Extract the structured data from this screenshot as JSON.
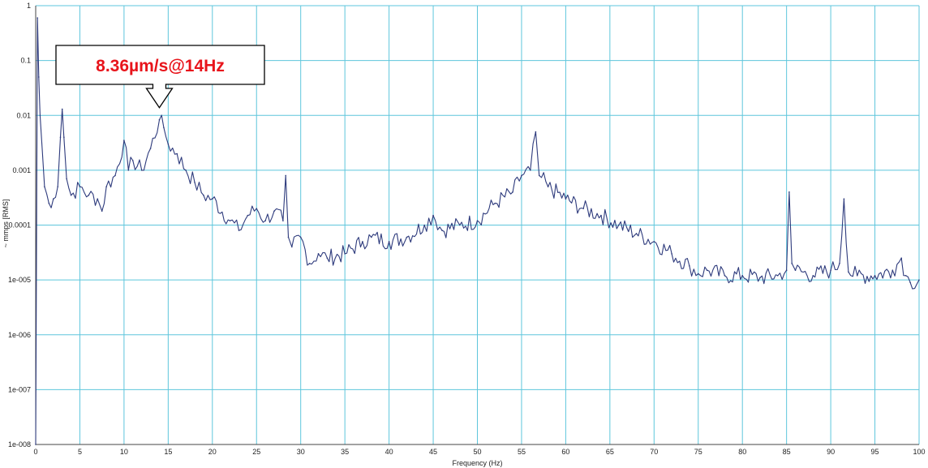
{
  "chart_data": {
    "type": "line",
    "xlabel": "Frequency (Hz)",
    "ylabel": "~ mmps [RMS]",
    "xlim": [
      0,
      100
    ],
    "ylim": [
      1e-08,
      1
    ],
    "yscale": "log",
    "grid": true,
    "x_tick_labels": [
      "0",
      "5",
      "10",
      "15",
      "20",
      "25",
      "30",
      "35",
      "40",
      "45",
      "50",
      "55",
      "60",
      "65",
      "70",
      "75",
      "80",
      "85",
      "90",
      "95",
      "100"
    ],
    "y_tick_labels": [
      "1",
      "0.1",
      "0.01",
      "0.001",
      "0.0001",
      "1e-005",
      "1e-006",
      "1e-007",
      "1e-008"
    ],
    "series": [
      {
        "color": "#2d3a7c",
        "x": [
          0,
          0.2,
          0.35,
          0.5,
          1.0,
          1.5,
          2.0,
          2.5,
          2.8,
          3.0,
          3.2,
          3.5,
          4.0,
          5.0,
          6.0,
          7.0,
          7.5,
          8.0,
          9.0,
          10.0,
          10.5,
          11.0,
          12.0,
          13.0,
          14.0,
          14.5,
          15.0,
          16.0,
          17.0,
          18.0,
          19.0,
          20.0,
          22.0,
          23.0,
          24.0,
          25.0,
          26.0,
          27.0,
          28.0,
          28.3,
          28.6,
          29.0,
          30.0,
          31.0,
          32.0,
          33.0,
          35.0,
          37.0,
          38.0,
          40.0,
          42.0,
          44.0,
          45.0,
          46.0,
          48.0,
          50.0,
          52.0,
          54.0,
          55.0,
          56.0,
          56.6,
          57.0,
          58.0,
          60.0,
          62.0,
          64.0,
          66.0,
          68.0,
          70.0,
          72.0,
          74.0,
          75.0,
          76.0,
          78.0,
          80.0,
          82.0,
          84.0,
          85.0,
          85.3,
          85.6,
          86.0,
          88.0,
          90.0,
          91.0,
          91.5,
          92.0,
          93.0,
          95.0,
          97.0,
          98.0,
          98.5,
          99.0,
          100.0
        ],
        "y": [
          1e-08,
          0.6,
          0.05,
          0.01,
          0.0005,
          0.00025,
          0.0003,
          0.0005,
          0.004,
          0.013,
          0.004,
          0.0007,
          0.00035,
          0.0005,
          0.00035,
          0.0003,
          0.00018,
          0.0005,
          0.0008,
          0.0035,
          0.001,
          0.0015,
          0.001,
          0.0025,
          0.0083,
          0.006,
          0.003,
          0.002,
          0.001,
          0.0006,
          0.00035,
          0.0003,
          0.00012,
          8e-05,
          0.00015,
          0.0002,
          0.00012,
          0.00018,
          0.00012,
          0.0008,
          6e-05,
          4e-05,
          6e-05,
          2e-05,
          3e-05,
          2.5e-05,
          3e-05,
          5e-05,
          6e-05,
          5e-05,
          6e-05,
          0.0001,
          0.00015,
          8e-05,
          0.0001,
          0.00012,
          0.00025,
          0.0004,
          0.0008,
          0.001,
          0.005,
          0.0008,
          0.0005,
          0.0003,
          0.0002,
          0.00015,
          0.0001,
          7e-05,
          5e-05,
          3e-05,
          1.8e-05,
          1.3e-05,
          1.5e-05,
          1.2e-05,
          1.2e-05,
          1.1e-05,
          1.2e-05,
          1.5e-05,
          0.0004,
          2e-05,
          1.5e-05,
          1.2e-05,
          1.5e-05,
          2e-05,
          0.0003,
          1.4e-05,
          1.2e-05,
          1.2e-05,
          1.5e-05,
          2.5e-05,
          1.2e-05,
          9e-06,
          1e-05
        ]
      }
    ],
    "annotation": {
      "text": "8.36µm/s@14Hz",
      "x": 14,
      "y": 0.0083
    }
  },
  "colors": {
    "grid": "#5ec6dc",
    "line": "#2d3a7c",
    "callout_text": "#e8141b"
  }
}
